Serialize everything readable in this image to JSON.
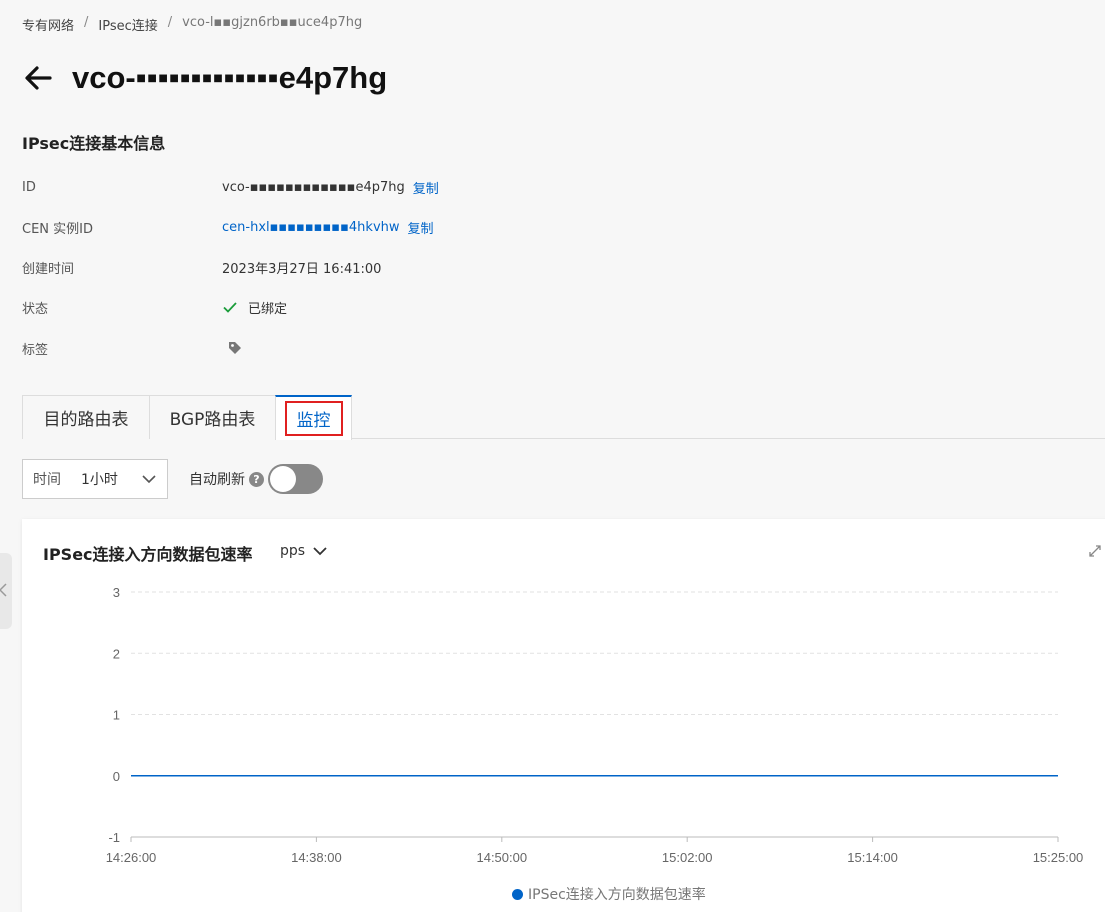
{
  "breadcrumb": [
    "专有网络",
    "IPsec连接",
    "vco-l▪▪gjzn6rb▪▪uce4p7hg"
  ],
  "title": "vco-▪▪▪▪▪▪▪▪▪▪▪▪▪e4p7hg",
  "section_title": "IPsec连接基本信息",
  "info": {
    "id_label": "ID",
    "id_value": "vco-▪▪▪▪▪▪▪▪▪▪▪▪e4p7hg",
    "copy": "复制",
    "cen_label": "CEN 实例ID",
    "cen_value": "cen-hxl▪▪▪▪▪▪▪▪▪4hkvhw",
    "created_label": "创建时间",
    "created_value": "2023年3月27日 16:41:00",
    "status_label": "状态",
    "status_value": "已绑定",
    "tags_label": "标签"
  },
  "tabs": [
    "目的路由表",
    "BGP路由表",
    "监控"
  ],
  "controls": {
    "time_label": "时间",
    "time_value": "1小时",
    "auto_refresh": "自动刷新",
    "help": "?",
    "auto_refresh_on": false
  },
  "chart": {
    "unit": "pps",
    "accent": "#0064c8"
  },
  "chart_data": {
    "type": "line",
    "title": "IPSec连接入方向数据包速率",
    "x": [
      "14:26:00",
      "14:38:00",
      "14:50:00",
      "15:02:00",
      "15:14:00",
      "15:25:00"
    ],
    "yticks": [
      "3",
      "2",
      "1",
      "0",
      "-1"
    ],
    "ylim": [
      -1,
      3
    ],
    "series": [
      {
        "name": "IPSec连接入方向数据包速率",
        "values": [
          0,
          0,
          0,
          0,
          0,
          0
        ]
      }
    ],
    "grid": true,
    "legend": "bottom"
  }
}
